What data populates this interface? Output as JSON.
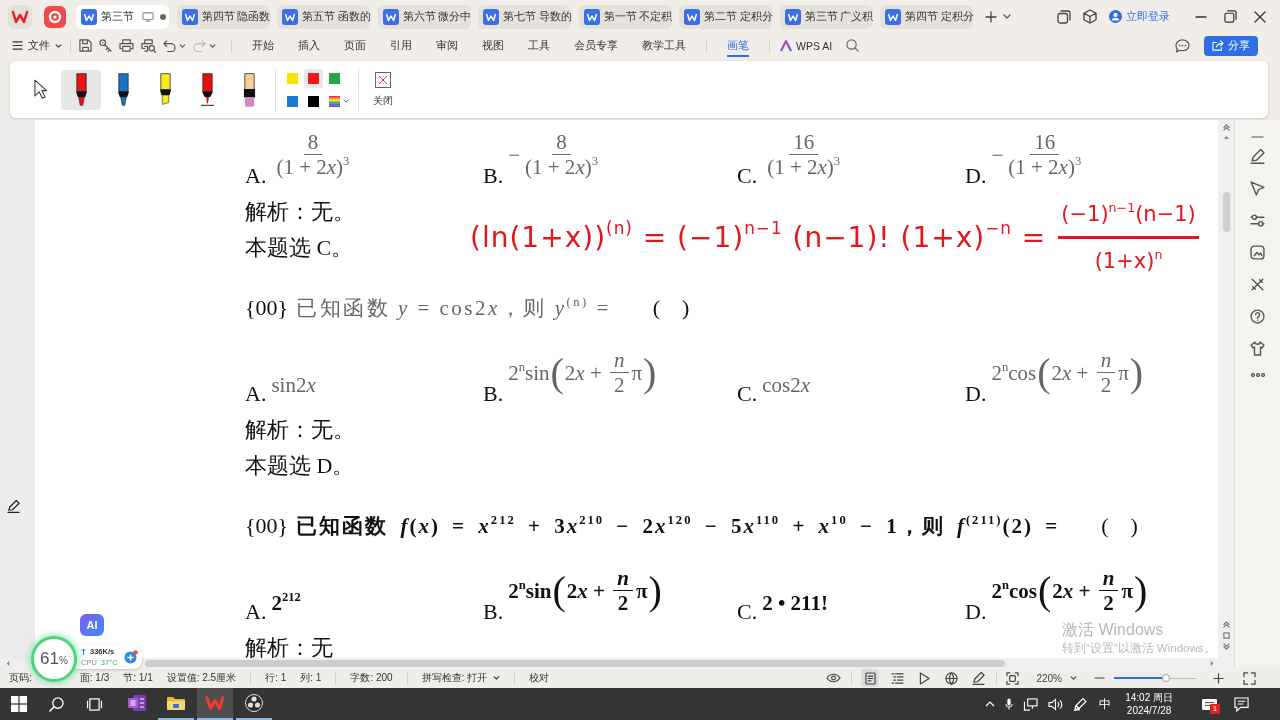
{
  "title_bar": {
    "tabs": [
      {
        "label": "第三节",
        "selected": true
      },
      {
        "label": "第四节 隐函数",
        "selected": false
      },
      {
        "label": "第五节 函数的",
        "selected": false
      },
      {
        "label": "第六节 微分中",
        "selected": false
      },
      {
        "label": "第七节 导数的",
        "selected": false
      },
      {
        "label": "第一节 不定积",
        "selected": false
      },
      {
        "label": "第二节 定积分",
        "selected": false
      },
      {
        "label": "第三节 广义积",
        "selected": false
      },
      {
        "label": "第四节 定积分",
        "selected": false
      }
    ],
    "login": "立即登录"
  },
  "menu_bar": {
    "file": "文件",
    "ribbon_tabs": [
      {
        "label": "开始",
        "selected": false
      },
      {
        "label": "插入",
        "selected": false
      },
      {
        "label": "页面",
        "selected": false
      },
      {
        "label": "引用",
        "selected": false
      },
      {
        "label": "审阅",
        "selected": false
      },
      {
        "label": "视图",
        "selected": false
      },
      {
        "label": "工具",
        "selected": false
      },
      {
        "label": "会员专享",
        "selected": false
      },
      {
        "label": "教学工具",
        "selected": false
      },
      {
        "label": "画笔",
        "selected": true
      }
    ],
    "ai": "WPS AI",
    "share": "分享"
  },
  "pen_toolbar": {
    "tools": [
      {
        "kind": "pointer",
        "selected": false
      },
      {
        "kind": "marker",
        "color": "#e8131b",
        "selected": true
      },
      {
        "kind": "marker",
        "color": "#1a73c9",
        "selected": false
      },
      {
        "kind": "highlighter",
        "color": "#f5ee16",
        "selected": false
      },
      {
        "kind": "pen",
        "color": "#e50f0f",
        "selected": false
      },
      {
        "kind": "eraser",
        "selected": false
      }
    ],
    "swatches": [
      {
        "color": "#f7e406",
        "selected": false
      },
      {
        "color": "#f01818",
        "selected": true
      },
      {
        "color": "#27a848",
        "selected": false
      },
      {
        "color": "#1b79d0",
        "selected": false
      },
      {
        "color": "#000000",
        "selected": false
      }
    ],
    "close": "关闭"
  },
  "document": {
    "blocks": [
      {
        "kind": "options",
        "faded": true,
        "options": [
          {
            "label": "A.",
            "math": [
              {
                "kind": "frac",
                "num": [
                  "8"
                ],
                "den": [
                  "(1 + 2",
                  "*x*",
                  ")$^{3}$"
                ]
              }
            ]
          },
          {
            "label": "B.",
            "math": [
              {
                "kind": "text",
                "text": "−"
              },
              {
                "kind": "frac",
                "num": [
                  "8"
                ],
                "den": [
                  "(1 + 2",
                  "*x*",
                  ")$^{3}$"
                ]
              }
            ]
          },
          {
            "label": "C.",
            "math": [
              {
                "kind": "frac",
                "num": [
                  "16"
                ],
                "den": [
                  "(1 + 2",
                  "*x*",
                  ")$^{3}$"
                ]
              }
            ]
          },
          {
            "label": "D.",
            "math": [
              {
                "kind": "text",
                "text": "−"
              },
              {
                "kind": "frac",
                "num": [
                  "16"
                ],
                "den": [
                  "(1 + 2",
                  "*x*",
                  ")$^{3}$"
                ]
              }
            ]
          }
        ]
      },
      {
        "kind": "line",
        "text": "解析：无。"
      },
      {
        "kind": "line",
        "text": "本题选 C。"
      },
      {
        "kind": "question",
        "faded": true,
        "number": "{00}",
        "stem": [
          "已知函数 ",
          "*y*",
          " = cos2",
          "*x*",
          "，则 ",
          "*y*$^{(n)}$",
          " ="
        ],
        "brackets": "(    )"
      },
      {
        "kind": "options",
        "faded": true,
        "options": [
          {
            "label": "A.",
            "math": [
              {
                "kind": "text",
                "text": "sin2"
              },
              {
                "kind": "text",
                "text": "*x*"
              }
            ]
          },
          {
            "label": "B.",
            "math": [
              {
                "kind": "text",
                "text": "2$^{n}$sin"
              },
              {
                "kind": "open",
                "text": "("
              },
              {
                "kind": "text",
                "text": "2"
              },
              {
                "kind": "text",
                "text": "*x*"
              },
              {
                "kind": "text",
                "text": " + "
              },
              {
                "kind": "frac",
                "num": [
                  "*n*"
                ],
                "den": [
                  "2"
                ]
              },
              {
                "kind": "text",
                "text": "π"
              },
              {
                "kind": "close",
                "text": ")"
              }
            ]
          },
          {
            "label": "C.",
            "math": [
              {
                "kind": "text",
                "text": "cos2"
              },
              {
                "kind": "text",
                "text": "*x*"
              }
            ]
          },
          {
            "label": "D.",
            "math": [
              {
                "kind": "text",
                "text": "2$^{n}$cos"
              },
              {
                "kind": "open",
                "text": "("
              },
              {
                "kind": "text",
                "text": "2"
              },
              {
                "kind": "text",
                "text": "*x*"
              },
              {
                "kind": "text",
                "text": " + "
              },
              {
                "kind": "frac",
                "num": [
                  "*n*"
                ],
                "den": [
                  "2"
                ]
              },
              {
                "kind": "text",
                "text": "π"
              },
              {
                "kind": "close",
                "text": ")"
              }
            ]
          }
        ]
      },
      {
        "kind": "line",
        "text": "解析：无。"
      },
      {
        "kind": "line",
        "text": "本题选 D。"
      },
      {
        "kind": "question",
        "faded": false,
        "number": "{00}",
        "stem": [
          "已知函数 ",
          "*f*",
          "(",
          "*x*",
          ") = ",
          "*x*",
          "$^{212}$ + 3",
          "*x*",
          "$^{210}$ − 2",
          "*x*",
          "$^{120}$ − 5",
          "*x*",
          "$^{110}$ + ",
          "*x*",
          "$^{10}$ − 1，则 ",
          "*f*",
          "$^{(211)}$(2) ="
        ],
        "brackets": "(    )"
      },
      {
        "kind": "options",
        "faded": false,
        "options": [
          {
            "label": "A.",
            "math": [
              {
                "kind": "text",
                "text": "2$^{212}$"
              }
            ]
          },
          {
            "label": "B.",
            "math": [
              {
                "kind": "text",
                "text": "2$^{n}$sin"
              },
              {
                "kind": "open",
                "text": "("
              },
              {
                "kind": "text",
                "text": "2"
              },
              {
                "kind": "text",
                "text": "*x*"
              },
              {
                "kind": "text",
                "text": " + "
              },
              {
                "kind": "frac",
                "num": [
                  "*n*"
                ],
                "den": [
                  "2"
                ]
              },
              {
                "kind": "text",
                "text": "π"
              },
              {
                "kind": "close",
                "text": ")"
              }
            ]
          },
          {
            "label": "C.",
            "math": [
              {
                "kind": "text",
                "text": "2 • 211!"
              }
            ]
          },
          {
            "label": "D.",
            "math": [
              {
                "kind": "text",
                "text": "2$^{n}$cos"
              },
              {
                "kind": "open",
                "text": "("
              },
              {
                "kind": "text",
                "text": "2"
              },
              {
                "kind": "text",
                "text": "*x*"
              },
              {
                "kind": "text",
                "text": " + "
              },
              {
                "kind": "frac",
                "num": [
                  "*n*"
                ],
                "den": [
                  "2"
                ]
              },
              {
                "kind": "text",
                "text": "π"
              },
              {
                "kind": "close",
                "text": ")"
              }
            ]
          }
        ]
      },
      {
        "kind": "line",
        "text": "解析：无"
      }
    ]
  },
  "ink": {
    "equation": "(ln(1+x))$^{(n)}$ = (−1)$^{n−1}$ (n−1)! (1+x)$^{−n}$ =",
    "fraction": {
      "num": "(−1)$^{n−1}$(n−1)",
      "den": "(1+x)$^{n}$"
    }
  },
  "activation_notice": {
    "title": "激活 Windows",
    "hint": "转到“设置”以激活 Windows。"
  },
  "system_monitor": {
    "ai": "AI",
    "usage": "61",
    "unit": "%",
    "speed": "336K/s",
    "cpu_label": "CPU",
    "cpu_temp": "37°C"
  },
  "status_bar": {
    "groups": [
      {
        "items": [
          {
            "kind": "text",
            "text": "页码:"
          },
          {
            "kind": "text",
            "text": "面: 1/3"
          },
          {
            "kind": "text",
            "text": "节: 1/1"
          },
          {
            "kind": "text",
            "text": "设置值: 2.5厘米"
          }
        ]
      },
      {
        "items": [
          {
            "kind": "text",
            "text": "行: 1"
          },
          {
            "kind": "text",
            "text": "列: 1"
          }
        ]
      },
      {
        "items": [
          {
            "kind": "text",
            "text": "字数: 200"
          }
        ]
      },
      {
        "items": [
          {
            "kind": "dropdown",
            "text": "拼写检查: 打开"
          }
        ]
      },
      {
        "items": [
          {
            "kind": "text",
            "text": "校对"
          }
        ]
      }
    ],
    "views": [
      {
        "kind": "read",
        "selected": false
      },
      {
        "kind": "page",
        "selected": true
      },
      {
        "kind": "outline",
        "selected": false
      },
      {
        "kind": "play",
        "selected": false
      },
      {
        "kind": "web",
        "selected": false
      },
      {
        "kind": "pen",
        "selected": false
      }
    ],
    "zoom": "220%",
    "zoom_slider": {
      "level": 0.63
    }
  },
  "taskbar": {
    "apps": [
      {
        "kind": "notes",
        "selected": false,
        "running": false
      },
      {
        "kind": "folder",
        "selected": false,
        "running": true
      },
      {
        "kind": "office",
        "selected": true,
        "running": true
      },
      {
        "kind": "recorder",
        "selected": false,
        "running": true
      }
    ],
    "ime": "中",
    "time": "14:02 周日",
    "date": "2024/7/28",
    "badge": "1"
  }
}
